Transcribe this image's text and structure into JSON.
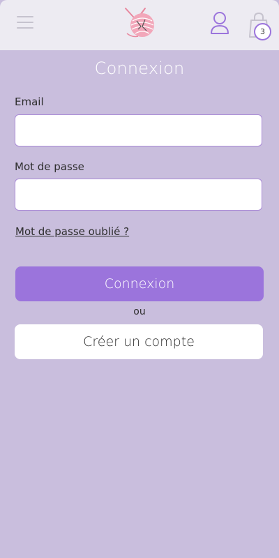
{
  "header": {
    "menu_icon": "hamburger-menu-icon",
    "logo_icon": "yarn-ball-knitting-needles-logo",
    "user_icon": "user-account-icon",
    "cart_icon": "shopping-bag-icon",
    "cart_count": "3"
  },
  "login": {
    "title": "Connexion",
    "email_label": "Email",
    "email_value": "",
    "password_label": "Mot de passe",
    "password_value": "",
    "forgot_password": "Mot de passe oublié ?",
    "submit_label": "Connexion",
    "or_text": "ou",
    "create_account_label": "Créer un compte"
  },
  "colors": {
    "background": "#c9bedd",
    "header": "#edebf2",
    "accent": "#9b74dc",
    "logo": "#f0a3b8"
  }
}
